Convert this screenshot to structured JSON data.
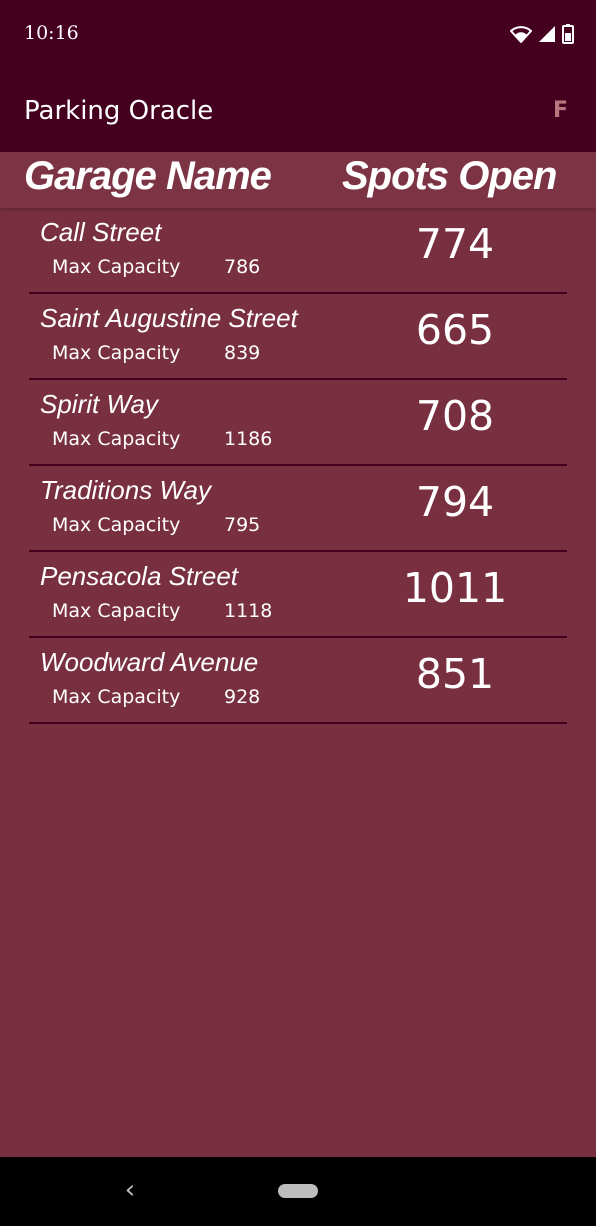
{
  "status_bar": {
    "time": "10:16",
    "icons": [
      "wifi-icon",
      "signal-icon",
      "battery-icon"
    ]
  },
  "app_bar": {
    "title": "Parking Oracle",
    "action_label": "F"
  },
  "table": {
    "header_name": "Garage Name",
    "header_spots": "Spots Open",
    "capacity_label": "Max Capacity",
    "rows": [
      {
        "name": "Call Street",
        "capacity": "786",
        "spots": "774"
      },
      {
        "name": "Saint Augustine Street",
        "capacity": "839",
        "spots": "665"
      },
      {
        "name": "Spirit Way",
        "capacity": "1186",
        "spots": "708"
      },
      {
        "name": "Traditions Way",
        "capacity": "795",
        "spots": "794"
      },
      {
        "name": "Pensacola Street",
        "capacity": "1118",
        "spots": "1011"
      },
      {
        "name": "Woodward Avenue",
        "capacity": "928",
        "spots": "851"
      }
    ]
  },
  "nav_bar": {
    "back_glyph": "‹",
    "icons": [
      "back-icon",
      "home-pill-icon"
    ]
  },
  "colors": {
    "primary_dark": "#450020",
    "background": "#782f40",
    "header_bg": "#7c3444",
    "accent": "#b9767f"
  }
}
